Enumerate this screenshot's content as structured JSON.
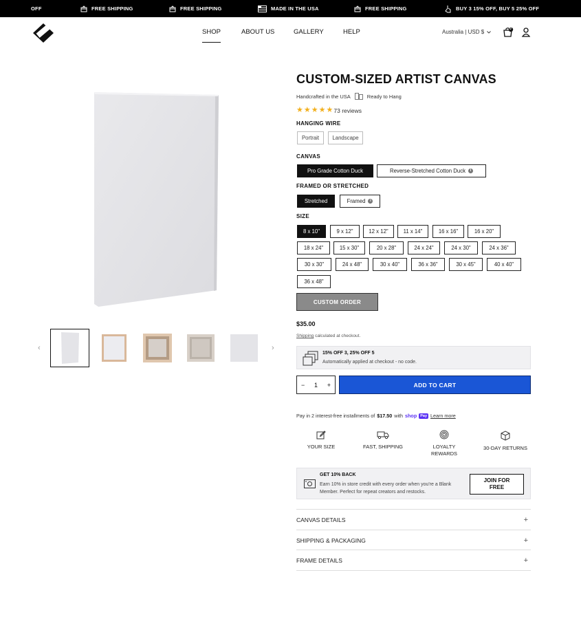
{
  "announcement": {
    "items": [
      {
        "icon": "gift-icon",
        "text": "FREE SHIPPING"
      },
      {
        "icon": "gift-icon",
        "text": "FREE SHIPPING"
      },
      {
        "icon": "flag-icon",
        "text": "MADE IN THE USA"
      },
      {
        "icon": "gift-icon",
        "text": "FREE SHIPPING"
      },
      {
        "icon": "tag-icon",
        "text": "BUY 3 15% OFF, BUY 5 25% OFF"
      }
    ],
    "cut_text": "OFF"
  },
  "header": {
    "nav": [
      "SHOP",
      "ABOUT US",
      "GALLERY",
      "HELP"
    ],
    "active_nav": "SHOP",
    "locale": "Australia | USD $",
    "cart_count": "0"
  },
  "product": {
    "title": "CUSTOM-SIZED ARTIST CANVAS",
    "badge_1": "Handcrafted in the USA",
    "badge_2": "Ready to Hang",
    "rating": 5,
    "reviews": "73 reviews",
    "options": {
      "hanging_wire": {
        "label": "HANGING WIRE",
        "values": [
          "Portrait",
          "Landscape"
        ]
      },
      "canvas": {
        "label": "CANVAS",
        "values": [
          "Pro Grade Cotton Duck",
          "Reverse-Stretched Cotton Duck"
        ],
        "selected": "Pro Grade Cotton Duck"
      },
      "framed": {
        "label": "FRAMED OR STRETCHED",
        "values": [
          "Stretched",
          "Framed"
        ],
        "selected": "Stretched"
      },
      "size": {
        "label": "SIZE",
        "selected": "8 x 10\"",
        "values": [
          "8 x 10\"",
          "9 x 12\"",
          "12 x 12\"",
          "11 x 14\"",
          "16 x 16\"",
          "16 x 20\"",
          "18 x 24\"",
          "15 x 30\"",
          "20 x 28\"",
          "24 x 24\"",
          "24 x 30\"",
          "24 x 36\"",
          "30 x 30\"",
          "24 x 48\"",
          "30 x 40\"",
          "36 x 36\"",
          "30 x 45\"",
          "40 x 40\"",
          "36 x 48\""
        ]
      }
    },
    "custom_order": "CUSTOM ORDER",
    "price": "$35.00",
    "shipping_word": "Shipping",
    "shipping_note": "calculated at checkout.",
    "promo_title": "15% OFF 3, 25% OFF 5",
    "promo_text": "Automatically applied at checkout - no code.",
    "quantity": "1",
    "qty_minus": "−",
    "qty_plus": "+",
    "add_to_cart": "ADD TO CART",
    "installments_pre": "Pay in 2 interest-free installments of",
    "installments_amount": "$17.50",
    "installments_with": "with",
    "shoppay": "shop",
    "shoppay_pay": "Pay",
    "learn_more": "Learn more",
    "features": [
      {
        "icon": "edit-size-icon",
        "label": "YOUR SIZE"
      },
      {
        "icon": "truck-icon",
        "label": "FAST, SHIPPING"
      },
      {
        "icon": "fingerprint-icon",
        "label": "LOYALTY REWARDS"
      },
      {
        "icon": "returns-box-icon",
        "label": "30-DAY RETURNS"
      }
    ],
    "rewards_title": "GET 10% BACK",
    "rewards_text": "Earn 10% in store credit with every order when you're a Blank Member. Perfect for repeat creators and restocks.",
    "join_label": "JOIN FOR FREE",
    "accordions": [
      "CANVAS DETAILS",
      "SHIPPING & PACKAGING",
      "FRAME DETAILS"
    ]
  },
  "gallery": {
    "prev": "‹",
    "next": "›",
    "thumbs": [
      "canvas-front",
      "frame-oak",
      "frame-walnut",
      "frame-back",
      "canvas-flat"
    ]
  },
  "colors": {
    "accent": "#1a56d6",
    "star": "#f2b01e",
    "selected_option": "#111111",
    "shop_pay": "#5a31f4"
  }
}
